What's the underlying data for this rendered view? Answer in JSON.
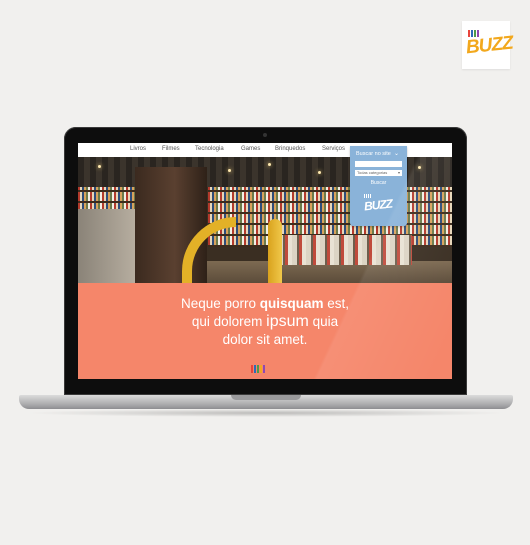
{
  "brand": {
    "logo_icon": "buzz-logo",
    "wordmark": "BUZZ",
    "tagline": "",
    "colors": [
      "#e8453c",
      "#2d6bb8",
      "#f2a81d",
      "#4d9b4a",
      "#8e4ab0"
    ]
  },
  "nav": {
    "items": [
      "Livros",
      "Filmes",
      "Tecnologia",
      "Games",
      "Brinquedos",
      "Serviços"
    ]
  },
  "search": {
    "title": "Buscar no site",
    "chevron_icon": "chevron-down-icon",
    "input_value": "",
    "category_selected": "Todas categorias",
    "button_label": "Buscar",
    "logo_text": "BUZZ"
  },
  "hero": {
    "image": "bookstore-interior",
    "strip_colors": [
      "#7fb04a",
      "#f5866a",
      "#f0c63a",
      "#8ab3d9",
      "#f5866a"
    ]
  },
  "headline": {
    "line1_plain": "Neque porro ",
    "line1_bold": "quisquam",
    "line1_end": " est,",
    "line2_start": "qui dolorem ",
    "line2_big": "ipsum",
    "line2_end": " quia",
    "line3": "dolor sit amet."
  },
  "colors": {
    "coral": "#f5866a",
    "search_blue": "#8ab3d9"
  }
}
